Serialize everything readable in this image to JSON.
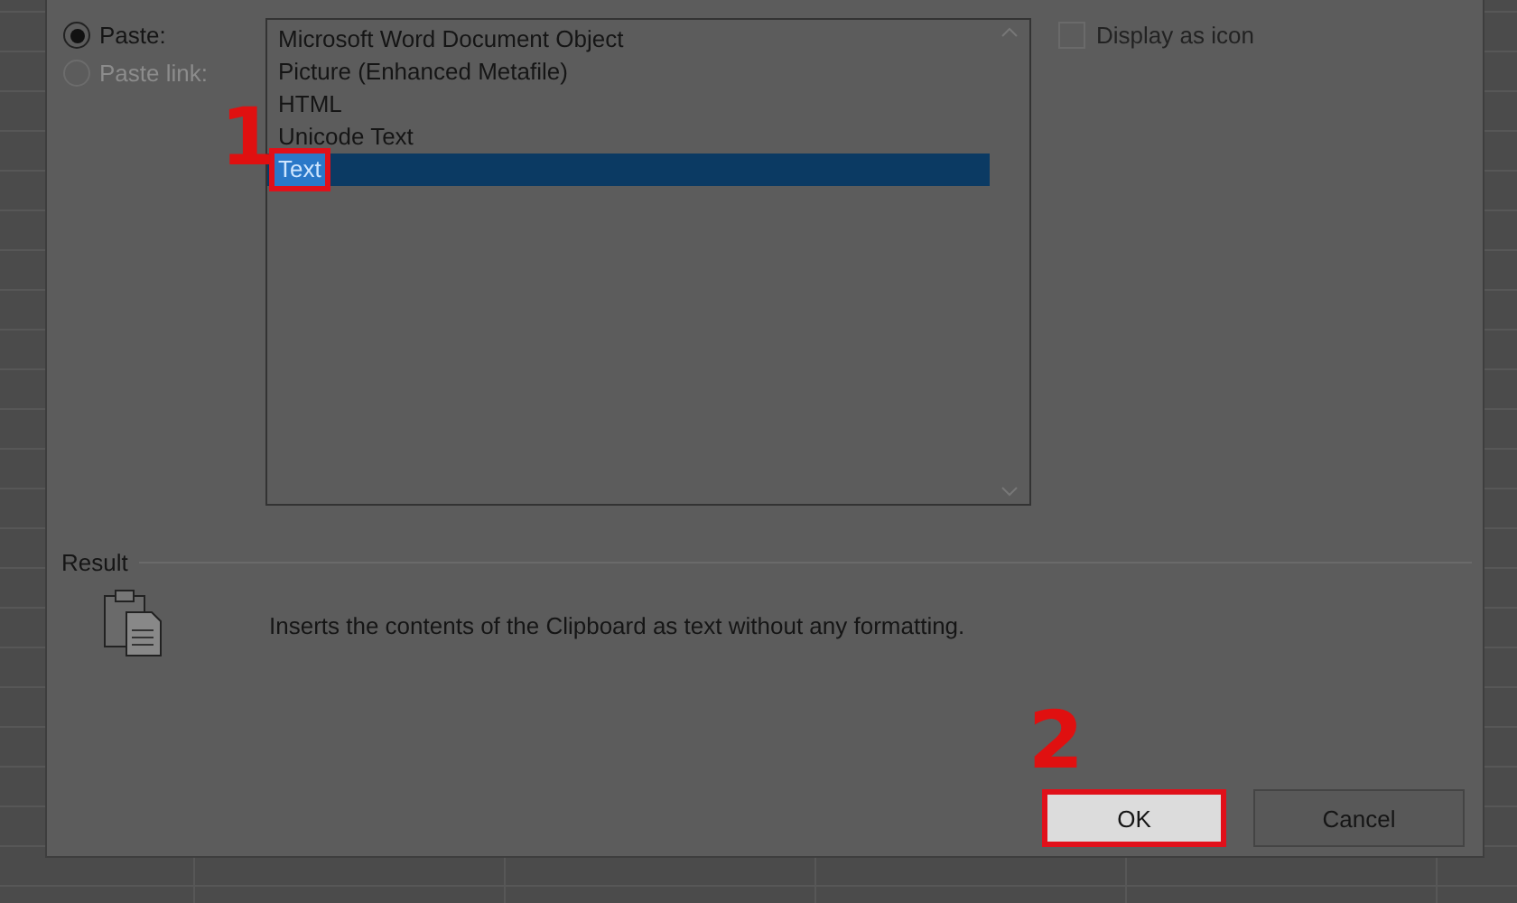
{
  "dialog": {
    "options": [
      {
        "label": "Paste:",
        "selected": true,
        "disabled": false
      },
      {
        "label": "Paste link:",
        "selected": false,
        "disabled": true
      }
    ],
    "list": {
      "items": [
        {
          "label": "Microsoft Word Document Object",
          "selected": false
        },
        {
          "label": "Picture (Enhanced Metafile)",
          "selected": false
        },
        {
          "label": "HTML",
          "selected": false
        },
        {
          "label": "Unicode Text",
          "selected": false
        },
        {
          "label": "Text",
          "selected": true
        }
      ]
    },
    "display_as_icon": {
      "label": "Display as icon",
      "checked": false
    },
    "result": {
      "title": "Result",
      "description": "Inserts the contents of the Clipboard as text without any formatting."
    },
    "buttons": [
      {
        "label": "OK",
        "kind": "default"
      },
      {
        "label": "Cancel",
        "kind": "normal"
      }
    ]
  },
  "annotations": [
    {
      "label": "1"
    },
    {
      "label": "2"
    }
  ]
}
